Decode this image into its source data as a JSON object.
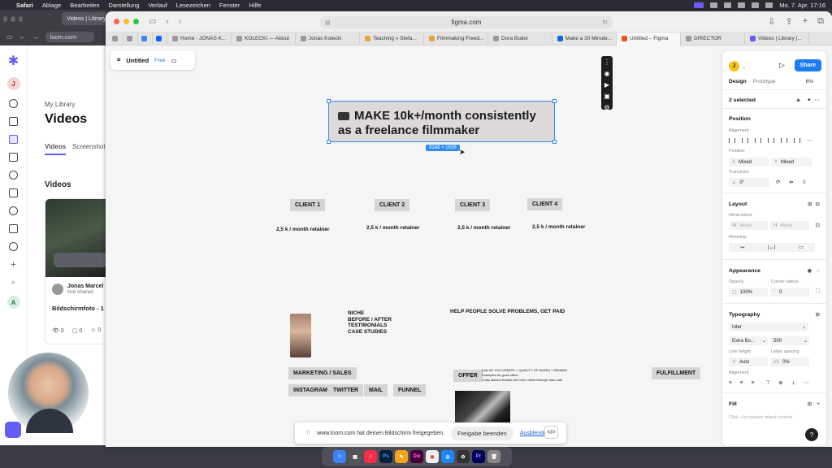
{
  "menubar": {
    "app": "Safari",
    "items": [
      "Ablage",
      "Bearbeiten",
      "Darstellung",
      "Verlauf",
      "Lesezeichen",
      "Fenster",
      "Hilfe"
    ],
    "clock": "Mo. 7. Apr. 17:16"
  },
  "loom_window": {
    "tab_title": "Videos | Library | Loom",
    "url": "loom.com",
    "avatar_letter": "J",
    "library_label": "My Library",
    "page_title": "Videos",
    "tabs": [
      "Videos",
      "Screenshots"
    ],
    "section_title": "Videos",
    "card": {
      "user_name": "Jonas Marcel",
      "share_status": "Not shared",
      "title": "Bildschirmfoto - 1",
      "views": "0",
      "comments": "0",
      "reactions": "0"
    },
    "sidebar_bottom_letter": "A"
  },
  "safari": {
    "url": "figma.com",
    "tabs": [
      {
        "label": "",
        "icon": "sidebar-tab-icon"
      },
      {
        "label": "",
        "icon": "tab-overview-icon"
      },
      {
        "label": "",
        "icon": "google-icon"
      },
      {
        "label": "",
        "icon": "meta-icon"
      },
      {
        "label": "Home - JONAS K...",
        "icon": "page-icon"
      },
      {
        "label": "KOLECKI — About",
        "icon": "page-icon"
      },
      {
        "label": "Jonas Kolecki",
        "icon": "globe-icon"
      },
      {
        "label": "Teaching » Stefa...",
        "icon": "chrome-icon"
      },
      {
        "label": "Filmmaking Freed...",
        "icon": "chrome-icon"
      },
      {
        "label": "Dora Budor",
        "icon": "globe-icon"
      },
      {
        "label": "Make a 30 Minute...",
        "icon": "trello-icon"
      },
      {
        "label": "Untitled – Figma",
        "icon": "figma-icon"
      },
      {
        "label": "DIRECTOR",
        "icon": "page-icon"
      },
      {
        "label": "Videos | Library |...",
        "icon": "loom-icon"
      }
    ]
  },
  "figma": {
    "file_title": "Untitled",
    "plan_badge": "Free",
    "headline_line1": "MAKE 10k+/month consistently",
    "headline_line2": "as a freelance filmmaker",
    "size_badge": "9148 × 1639",
    "clients": [
      "CLIENT 1",
      "CLIENT 2",
      "CLIENT 3",
      "CLIENT 4"
    ],
    "retainer": "2,5 k / month retainer",
    "niche_notes": [
      "NICHE",
      "BEFORE / AFTER",
      "TESTIMONIALS",
      "CASE STUDIES"
    ],
    "tagline": "HELP PEOPLE SOLVE PROBLEMS, GET PAID",
    "chips": {
      "marketing": "MARKETING / SALES",
      "instagram": "INSTAGRAM",
      "twitter": "TWITTER",
      "mail": "MAIL",
      "funnel": "FUNNEL",
      "offer": "OFFER",
      "fulfillment": "FULFILLMENT"
    },
    "offer_notes": [
      "(VALUE YOU CREATE × QUALITY OF WORK) * DEMAND",
      "Examples for good offers:",
      "I help fashion brands sell more online through video ads"
    ]
  },
  "share_bar": {
    "message": "www.loom.com hat deinen Bildschirm freigegeben.",
    "stop_label": "Freigabe beenden",
    "hide_label": "Ausblenden"
  },
  "panel": {
    "avatar_letter": "J",
    "share_label": "Share",
    "tab_design": "Design",
    "tab_prototype": "Prototype",
    "zoom": "6%",
    "selection_label": "2 selected",
    "position_title": "Position",
    "alignment_label": "Alignment",
    "position_label": "Position",
    "x_label": "X",
    "x_value": "Mixed",
    "y_label": "Y",
    "y_value": "Mixed",
    "transform_label": "Transform",
    "rotation": "0°",
    "layout_title": "Layout",
    "dimensions_label": "Dimensions",
    "w_label": "W",
    "w_value": "Mixed",
    "h_label": "H",
    "h_value": "Mixed",
    "resizing_label": "Resizing",
    "appearance_title": "Appearance",
    "opacity_label": "Opacity",
    "opacity_value": "100%",
    "corner_label": "Corner radius",
    "corner_value": "0",
    "typography_title": "Typography",
    "font_family": "Inter",
    "font_weight": "Extra Bo...",
    "font_size": "500",
    "line_height_label": "Line height",
    "line_height_value": "Auto",
    "letter_spacing_label": "Letter spacing",
    "letter_spacing_value": "0%",
    "alignment2_label": "Alignment",
    "fill_title": "Fill",
    "fill_hint": "Click + to replace mixed content"
  },
  "colors": {
    "figma_blue": "#1e7cf2",
    "selection_blue": "#2f8cf0",
    "loom_purple": "#625df5"
  }
}
